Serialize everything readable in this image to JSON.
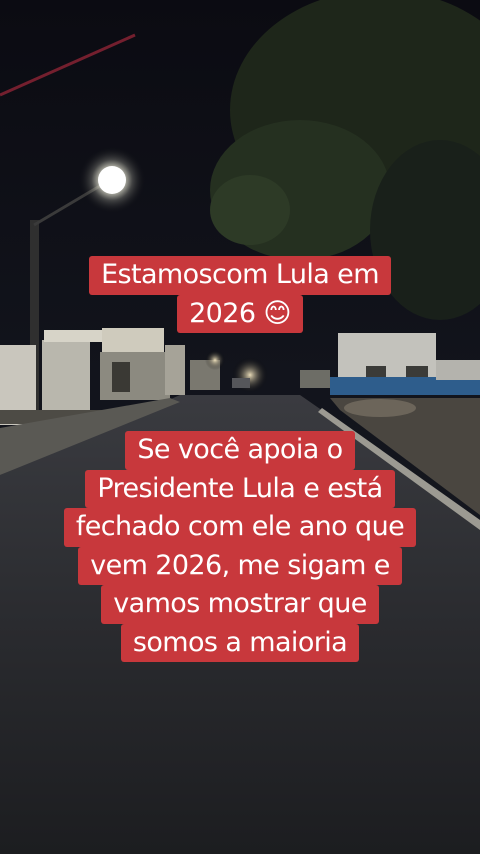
{
  "story": {
    "caption_top_lines": [
      "Estamoscom Lula em",
      "2026 😊"
    ],
    "caption_main_lines": [
      "Se você apoia o",
      "Presidente Lula e está",
      "fechado com ele ano que",
      "vem 2026, me sigam e",
      "vamos mostrar que",
      "somos a maioria"
    ]
  },
  "colors": {
    "caption_bg": "#c8383c",
    "caption_text": "#ffffff"
  }
}
